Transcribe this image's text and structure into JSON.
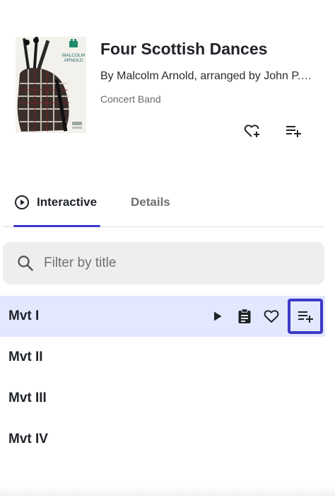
{
  "album": {
    "title": "Four Scottish Dances",
    "subtitle": "By Malcolm Arnold, arranged by John P. Paynter",
    "ensemble": "Concert Band",
    "cover_text": {
      "composer_line1": "MALCOLM",
      "composer_line2": "ARNOLD"
    },
    "favorite_icon": "heart-plus-icon",
    "queue_icon": "playlist-add-icon"
  },
  "tabs": [
    {
      "label": "Interactive",
      "icon": "play-circle-icon",
      "active": true
    },
    {
      "label": "Details",
      "active": false
    }
  ],
  "search": {
    "placeholder": "Filter by title",
    "value": "",
    "icon": "search-icon"
  },
  "tracks": [
    {
      "title": "Mvt I",
      "selected": true
    },
    {
      "title": "Mvt II",
      "selected": false
    },
    {
      "title": "Mvt III",
      "selected": false
    },
    {
      "title": "Mvt IV",
      "selected": false
    }
  ],
  "track_actions": {
    "play_icon": "play-icon",
    "notes_icon": "clipboard-icon",
    "favorite_icon": "heart-icon",
    "queue_icon": "playlist-add-icon"
  },
  "colors": {
    "accent": "#3d3ac8",
    "selected_row": "#e3e8ff",
    "search_bg": "#eeeeee"
  }
}
